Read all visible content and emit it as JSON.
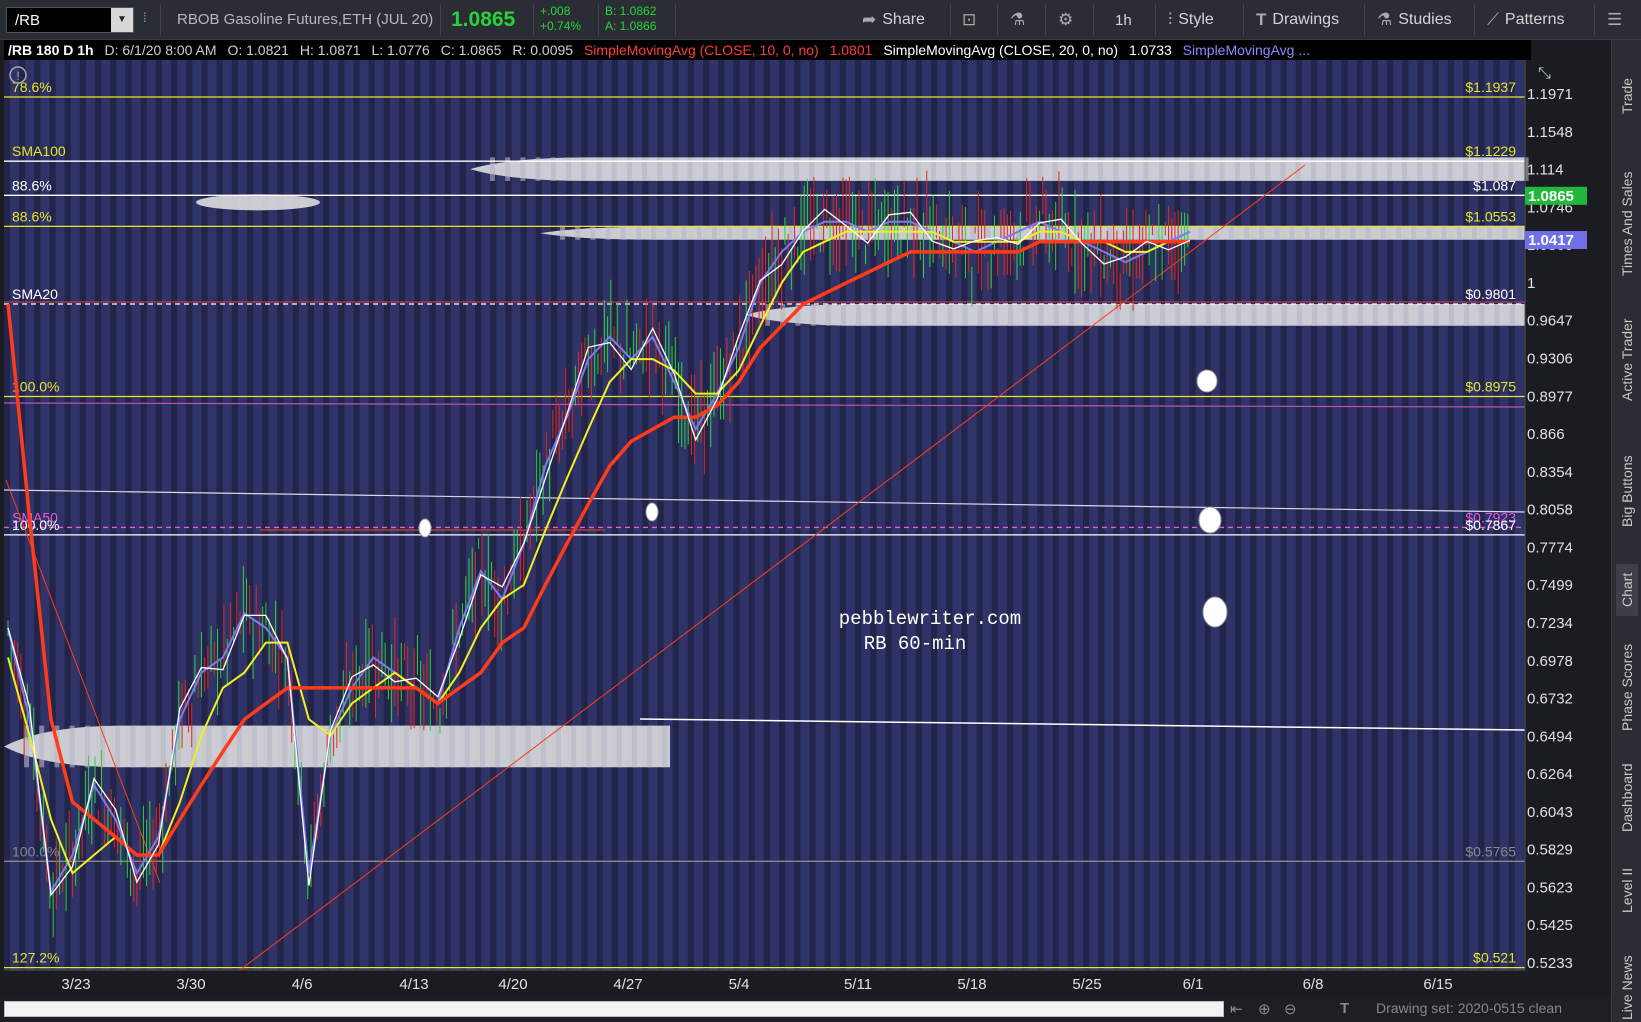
{
  "toolbar": {
    "symbol": "/RB",
    "description": "RBOB Gasoline Futures,ETH (JUL 20)",
    "last": "1.0865",
    "change": "+.008",
    "change_pct": "+0.74%",
    "bid": "B: 1.0862",
    "ask": "A: 1.0866",
    "share": "Share",
    "interval": "1h",
    "style": "Style",
    "drawings": "Drawings",
    "studies": "Studies",
    "patterns": "Patterns"
  },
  "header": {
    "symbol_period": "/RB 180 D 1h",
    "date": "D: 6/1/20 8:00 AM",
    "open": "O: 1.0821",
    "high": "H: 1.0871",
    "low": "L: 1.0776",
    "close": "C: 1.0865",
    "range": "R: 0.0095",
    "sma10_label": "SimpleMovingAvg (CLOSE, 10, 0, no)",
    "sma10_value": "1.0801",
    "sma20_label": "SimpleMovingAvg (CLOSE, 20, 0, no)",
    "sma20_value": "1.0733",
    "sma_more": "SimpleMovingAvg ..."
  },
  "sidebar": {
    "items": [
      "Trade",
      "Times And Sales",
      "Active Trader",
      "Big Buttons",
      "Chart",
      "Phase Scores",
      "Dashboard",
      "Level II",
      "Live News"
    ],
    "active": "Chart"
  },
  "chart_data": {
    "type": "line",
    "title": "pebblewriter.com",
    "subtitle": "RB 60-min",
    "x_ticks": [
      "3/23",
      "3/30",
      "4/6",
      "4/13",
      "4/20",
      "4/27",
      "5/4",
      "5/11",
      "5/18",
      "5/25",
      "6/1",
      "6/8",
      "6/15"
    ],
    "y_ticks": [
      "1.1971",
      "1.1548",
      "1.114",
      "1.0746",
      "1.0366",
      "1",
      "0.9647",
      "0.9306",
      "0.8977",
      "0.866",
      "0.8354",
      "0.8058",
      "0.7774",
      "0.7499",
      "0.7234",
      "0.6978",
      "0.6732",
      "0.6494",
      "0.6264",
      "0.6043",
      "0.5829",
      "0.5623",
      "0.5425",
      "0.5233"
    ],
    "ylim": [
      0.5233,
      1.2
    ],
    "y_scale": "log",
    "price_badges": [
      {
        "label": "1.0865",
        "value": 1.0865,
        "color": "#1fb83a"
      },
      {
        "label": "1.0417",
        "value": 1.0417,
        "color": "#6f6fe8"
      }
    ],
    "levels": [
      {
        "left": "78.6%",
        "right": "$1.1937",
        "value": 1.1937,
        "color": "#e6e62a"
      },
      {
        "left": "SMA100",
        "right": "$1.1229",
        "value": 1.1229,
        "color": "#e6e62a",
        "left_color": "#e6e62a",
        "line": "#ffffff"
      },
      {
        "left": "88.6%",
        "right": "$1.087",
        "value": 1.087,
        "color": "#ffffff"
      },
      {
        "left": "88.6%",
        "right": "$1.0553",
        "value": 1.0553,
        "color": "#e6e62a"
      },
      {
        "left": "SMA20",
        "right": "$0.9801",
        "value": 0.9801,
        "color": "#ffffff"
      },
      {
        "left": "100.0%",
        "right": "$0.8975",
        "value": 0.8975,
        "color": "#e6e62a"
      },
      {
        "left": "SMA50",
        "right": "$0.7923",
        "value": 0.7923,
        "color": "#e05ce0"
      },
      {
        "left": "100.0%",
        "right": "$0.7867",
        "value": 0.7867,
        "color": "#ffffff"
      },
      {
        "left": "100.0%",
        "right": "$0.5765",
        "value": 0.5765,
        "color": "#888888"
      },
      {
        "left": "127.2%",
        "right": "$0.521",
        "value": 0.521,
        "color": "#e6e62a"
      }
    ],
    "series": [
      {
        "name": "SMA10",
        "color": "#7a7af0",
        "x": [
          0,
          2,
          4,
          6,
          8,
          10,
          12,
          14,
          16,
          18,
          20,
          22,
          24,
          26,
          28,
          30,
          32,
          34,
          36,
          38,
          40,
          42,
          44,
          46,
          48,
          50,
          52,
          54,
          56,
          58,
          60,
          62,
          64,
          66,
          68,
          70,
          72,
          74,
          76,
          78,
          80,
          82,
          84,
          86,
          88,
          90,
          92,
          94,
          96,
          98,
          100,
          102,
          104,
          106,
          108,
          110
        ],
        "y": [
          0.72,
          0.66,
          0.56,
          0.58,
          0.62,
          0.6,
          0.57,
          0.59,
          0.66,
          0.69,
          0.7,
          0.73,
          0.72,
          0.7,
          0.57,
          0.65,
          0.68,
          0.7,
          0.69,
          0.68,
          0.67,
          0.72,
          0.76,
          0.74,
          0.78,
          0.84,
          0.88,
          0.93,
          0.95,
          0.93,
          0.95,
          0.91,
          0.87,
          0.9,
          0.94,
          1.0,
          1.03,
          1.05,
          1.06,
          1.06,
          1.05,
          1.06,
          1.06,
          1.05,
          1.04,
          1.03,
          1.04,
          1.05,
          1.06,
          1.05,
          1.04,
          1.03,
          1.02,
          1.03,
          1.04,
          1.05
        ]
      },
      {
        "name": "SMA20",
        "color": "#f0f020",
        "x": [
          0,
          2,
          4,
          6,
          8,
          10,
          12,
          14,
          16,
          18,
          20,
          22,
          24,
          26,
          28,
          30,
          32,
          34,
          36,
          38,
          40,
          42,
          44,
          46,
          48,
          50,
          52,
          54,
          56,
          58,
          60,
          62,
          64,
          66,
          68,
          70,
          72,
          74,
          76,
          78,
          80,
          82,
          84,
          86,
          88,
          90,
          92,
          94,
          96,
          98,
          100,
          102,
          104,
          106,
          108,
          110
        ],
        "y": [
          0.7,
          0.65,
          0.6,
          0.57,
          0.58,
          0.59,
          0.58,
          0.58,
          0.61,
          0.65,
          0.68,
          0.69,
          0.71,
          0.71,
          0.66,
          0.65,
          0.67,
          0.68,
          0.69,
          0.68,
          0.67,
          0.69,
          0.72,
          0.74,
          0.75,
          0.79,
          0.83,
          0.87,
          0.91,
          0.93,
          0.93,
          0.92,
          0.9,
          0.9,
          0.92,
          0.96,
          1.0,
          1.03,
          1.04,
          1.05,
          1.05,
          1.05,
          1.05,
          1.05,
          1.04,
          1.04,
          1.04,
          1.04,
          1.05,
          1.05,
          1.04,
          1.04,
          1.03,
          1.03,
          1.04,
          1.04
        ]
      },
      {
        "name": "SMA50",
        "color": "#ff3b1a",
        "x": [
          0,
          2,
          4,
          6,
          8,
          10,
          12,
          14,
          16,
          18,
          20,
          22,
          24,
          26,
          28,
          30,
          32,
          34,
          36,
          38,
          40,
          42,
          44,
          46,
          48,
          50,
          52,
          54,
          56,
          58,
          60,
          62,
          64,
          66,
          68,
          70,
          72,
          74,
          76,
          78,
          80,
          82,
          84,
          86,
          88,
          90,
          92,
          94,
          96,
          98,
          100,
          102,
          104,
          106,
          108,
          110
        ],
        "y": [
          0.98,
          0.8,
          0.66,
          0.61,
          0.6,
          0.59,
          0.58,
          0.58,
          0.6,
          0.62,
          0.64,
          0.66,
          0.67,
          0.68,
          0.68,
          0.68,
          0.68,
          0.68,
          0.68,
          0.68,
          0.67,
          0.68,
          0.69,
          0.71,
          0.72,
          0.75,
          0.78,
          0.81,
          0.84,
          0.86,
          0.87,
          0.88,
          0.88,
          0.89,
          0.91,
          0.94,
          0.96,
          0.98,
          0.99,
          1.0,
          1.01,
          1.02,
          1.03,
          1.03,
          1.03,
          1.03,
          1.03,
          1.03,
          1.04,
          1.04,
          1.04,
          1.04,
          1.04,
          1.04,
          1.04,
          1.04
        ]
      }
    ],
    "xlabel": "",
    "ylabel": ""
  },
  "footer": {
    "drawing_set": "Drawing set: 2020-0515 clean"
  }
}
